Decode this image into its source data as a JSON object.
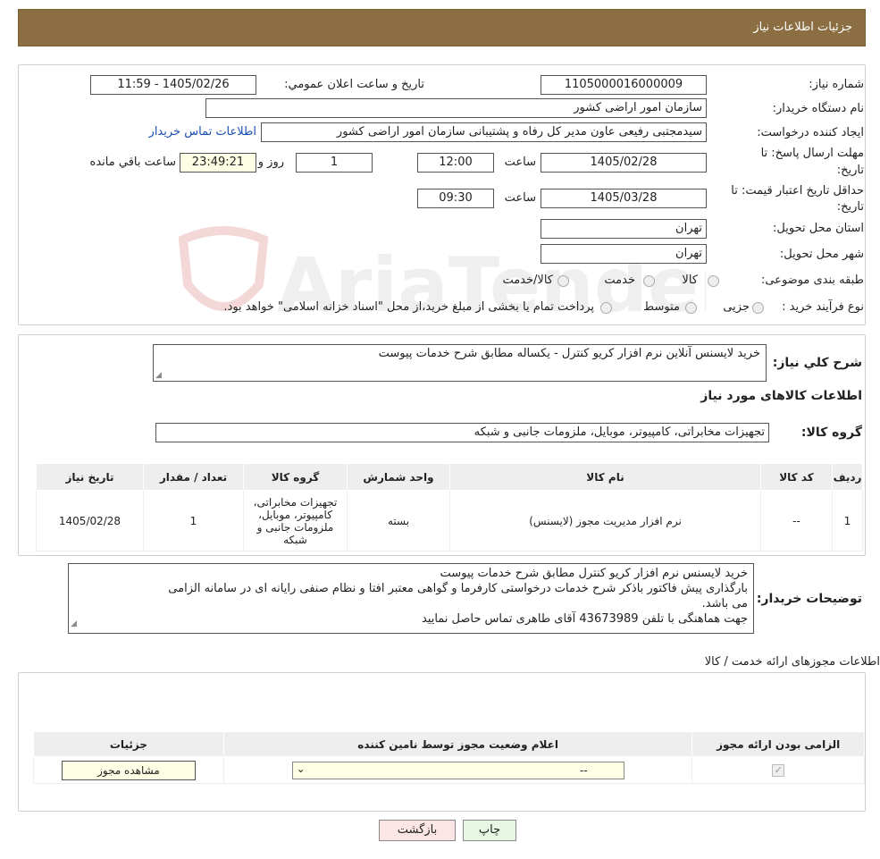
{
  "header": {
    "title": "جزئیات اطلاعات نیاز"
  },
  "form": {
    "need_no_label": "شماره نیاز:",
    "need_no": "1105000016000009",
    "announce_label": "تاریخ و ساعت اعلان عمومي:",
    "announce_value": "1405/02/26 - 11:59",
    "buyer_label": "نام دستگاه خریدار:",
    "buyer_value": "سازمان امور اراضی کشور",
    "creator_label": "ایجاد کننده درخواست:",
    "creator_value": "سیدمجتبی رفیعی عاون مدیر کل رفاه و پشتیبانی سازمان امور اراضی کشور",
    "contact_link": "اطلاعات تماس خریدار",
    "deadline_label_1": "مهلت ارسال پاسخ: تا",
    "deadline_label_2": "تاریخ:",
    "deadline_date": "1405/02/28",
    "time_label": "ساعت",
    "deadline_time": "12:00",
    "days_value": "1",
    "days_label": "روز و",
    "remaining_value": "23:49:21",
    "remaining_label": "ساعت باقي مانده",
    "validity_label_1": "حداقل تاریخ اعتبار قیمت: تا",
    "validity_label_2": "تاریخ:",
    "validity_date": "1405/03/28",
    "validity_time": "09:30",
    "province_label": "استان محل تحویل:",
    "province_value": "تهران",
    "city_label": "شهر محل تحویل:",
    "city_value": "تهران",
    "category_label": "طبقه بندی موضوعی:",
    "cat_goods": "کالا",
    "cat_service": "خدمت",
    "cat_both": "کالا/خدمت",
    "process_label": "نوع فرآیند خرید :",
    "proc_partial": "جزیی",
    "proc_medium": "متوسط",
    "proc_note": "پرداخت تمام یا بخشی از مبلغ خرید،از محل \"اسناد خزانه اسلامی\" خواهد بود."
  },
  "summary": {
    "desc_label": "شرح کلي نیاز:",
    "desc_value": "خرید لایسنس آنلاین نرم افزار کریو کنترل - یکساله مطابق شرح خدمات پیوست",
    "goods_info_title": "اطلاعات کالاهای مورد نیاز",
    "group_label": "گروه کالا:",
    "group_value": "تجهیزات مخابراتی، کامپیوتر، موبایل، ملزومات جانبی و شبکه"
  },
  "goods_table": {
    "headers": [
      "ردیف",
      "کد کالا",
      "نام کالا",
      "واحد شمارش",
      "گروه کالا",
      "تعداد / مقدار",
      "تاریخ نیاز"
    ],
    "row": [
      "1",
      "--",
      "نرم افزار مدیریت مجوز (لایسنس)",
      "بسته",
      "تجهیزات مخابراتی، کامپیوتر، موبایل، ملزومات جانبی و شبکه",
      "1",
      "1405/02/28"
    ]
  },
  "notes": {
    "label": "توضیحات خریدار:",
    "line1": "خرید لایسنس نرم افزار کریو کنترل مطابق شرح خدمات پیوست",
    "line2": "بارگذاری پیش فاکتور  باذکر شرح خدمات درخواستی کارفرما و گواهی معتبر افتا و نظام صنفی رایانه ای در سامانه الزامی",
    "line3": "می باشد.",
    "line4": "جهت هماهنگی با تلفن 43673989 آقای طاهری تماس حاصل نمایید"
  },
  "licenses": {
    "title": "اطلاعات مجوزهای ارائه خدمت / کالا",
    "headers": [
      "الزامی بودن ارائه مجوز",
      "اعلام وضعیت مجوز توسط نامین کننده",
      "جزئیات"
    ],
    "select_value": "--",
    "view_button": "مشاهده مجوز"
  },
  "buttons": {
    "print": "چاپ",
    "back": "بازگشت"
  },
  "watermark": {
    "text": "AriaTender.neT"
  }
}
